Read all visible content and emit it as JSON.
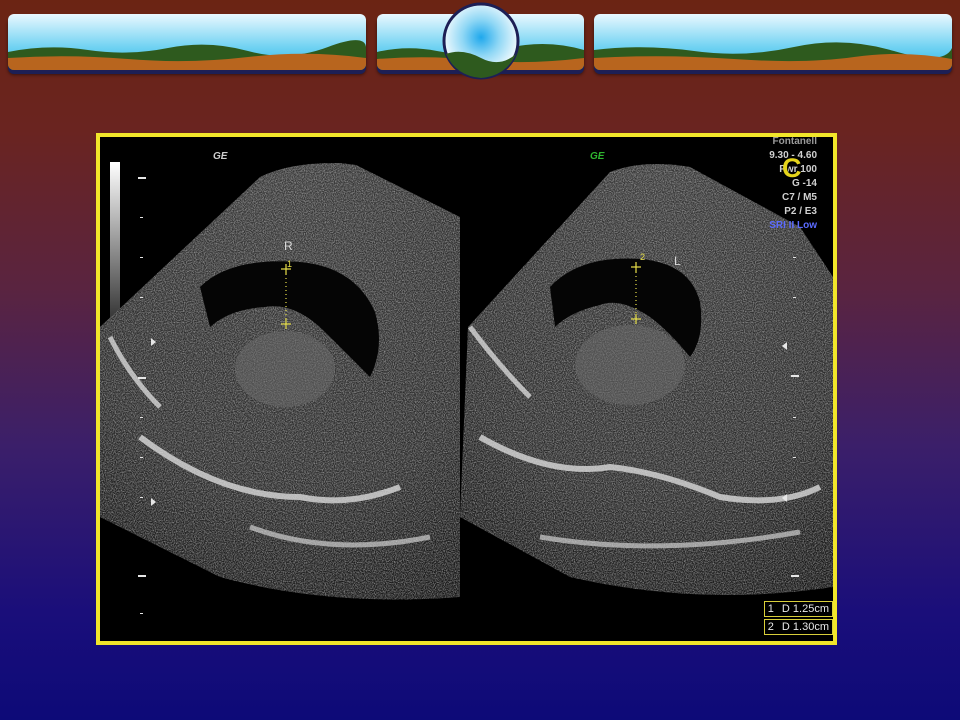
{
  "overlay": {
    "vendor_left": "GE",
    "vendor_right": "GE",
    "side_left": "R",
    "side_right": "L",
    "caliper_1": "1",
    "caliper_2": "2",
    "params": {
      "preset": "Fontanell",
      "freq": "9.30 - 4.60",
      "power": "Pwr 100",
      "gain": "G -14",
      "map": "C7 / M5",
      "persist": "P2 / E3",
      "sri": "SRI II Low"
    },
    "marker_letter": "C",
    "measurements": [
      {
        "index": "1",
        "value": "D 1.25cm"
      },
      {
        "index": "2",
        "value": "D 1.30cm"
      }
    ]
  },
  "colors": {
    "frame": "#f2e62a",
    "caliper": "#e8e04a",
    "sri_text": "#5b6bff",
    "ge_right": "#2fb52f"
  }
}
